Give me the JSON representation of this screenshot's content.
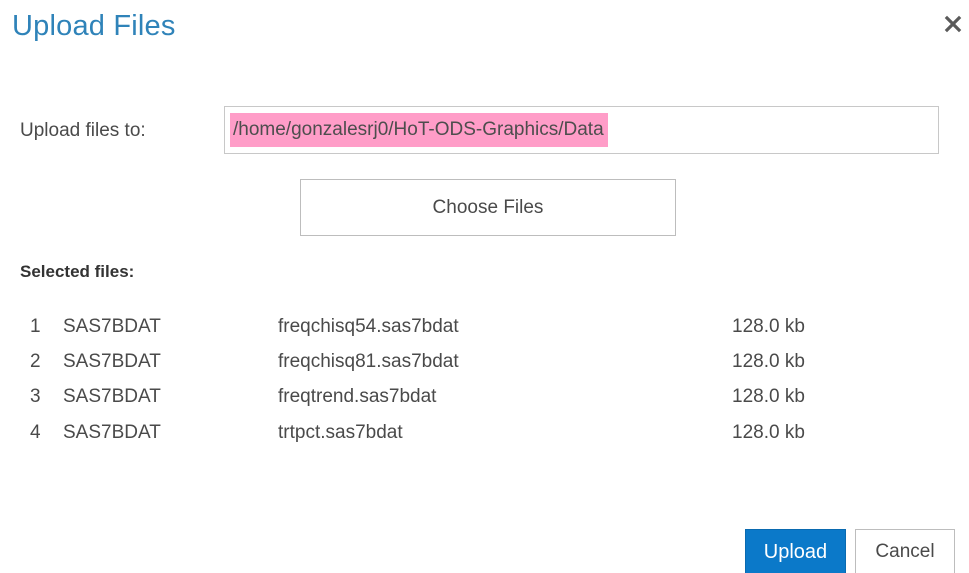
{
  "dialog": {
    "title": "Upload Files",
    "close_icon": "close-icon"
  },
  "upload_to": {
    "label": "Upload files to:",
    "value": "/home/gonzalesrj0/HoT-ODS-Graphics/Data",
    "highlight_color": "#ff9dc8"
  },
  "choose_button": {
    "label": "Choose Files"
  },
  "selected_files": {
    "heading": "Selected files:",
    "rows": [
      {
        "index": "1",
        "type": "SAS7BDAT",
        "name": "freqchisq54.sas7bdat",
        "size": "128.0 kb"
      },
      {
        "index": "2",
        "type": "SAS7BDAT",
        "name": "freqchisq81.sas7bdat",
        "size": "128.0 kb"
      },
      {
        "index": "3",
        "type": "SAS7BDAT",
        "name": "freqtrend.sas7bdat",
        "size": "128.0 kb"
      },
      {
        "index": "4",
        "type": "SAS7BDAT",
        "name": "trtpct.sas7bdat",
        "size": "128.0 kb"
      }
    ]
  },
  "footer": {
    "upload_label": "Upload",
    "cancel_label": "Cancel"
  },
  "colors": {
    "title": "#2f83b9",
    "primary_button": "#0b79c9"
  }
}
